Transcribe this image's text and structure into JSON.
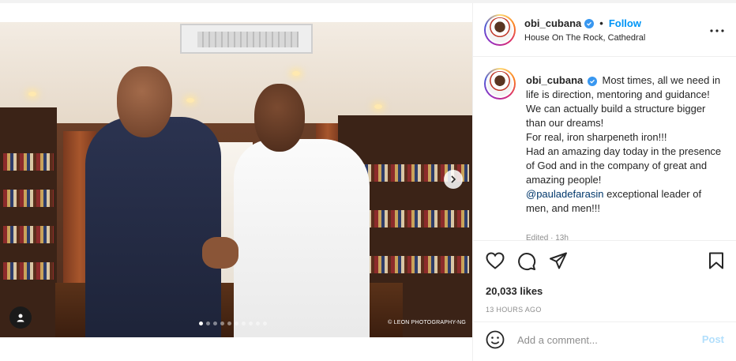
{
  "post": {
    "username": "obi_cubana",
    "follow_label": "Follow",
    "separator": "•",
    "location": "House On The Rock, Cathedral",
    "caption_lines": [
      "Most times, all we need in life is direction, mentoring and guidance!",
      "We can actually build a structure bigger than our dreams!",
      "For real, iron sharpeneth iron!!!",
      "Had an amazing day today in the presence of God and in the company of great and amazing people!"
    ],
    "mention": "@pauladefarasin",
    "mention_tail": " exceptional leader of men, and men!!!",
    "edited_label": "Edited · 13h",
    "likes": "20,033 likes",
    "timestamp": "13 HOURS AGO",
    "comment_placeholder": "Add a comment...",
    "post_label": "Post"
  },
  "media": {
    "watermark": "© LEON PHOTOGRAPHY-NG",
    "carousel_total": 10,
    "carousel_active": 1
  },
  "icons": {
    "verified": "verified-badge-icon",
    "more": "more-options-icon",
    "like": "heart-icon",
    "comment": "comment-bubble-icon",
    "share": "paper-plane-icon",
    "save": "bookmark-icon",
    "emoji": "emoji-smiley-icon",
    "next": "chevron-right-icon",
    "tagged": "user-tag-icon"
  },
  "colors": {
    "accent": "#0095f6",
    "verified": "#3897f0",
    "post_disabled": "#b2dffc",
    "secondary_text": "#8e8e8e"
  }
}
